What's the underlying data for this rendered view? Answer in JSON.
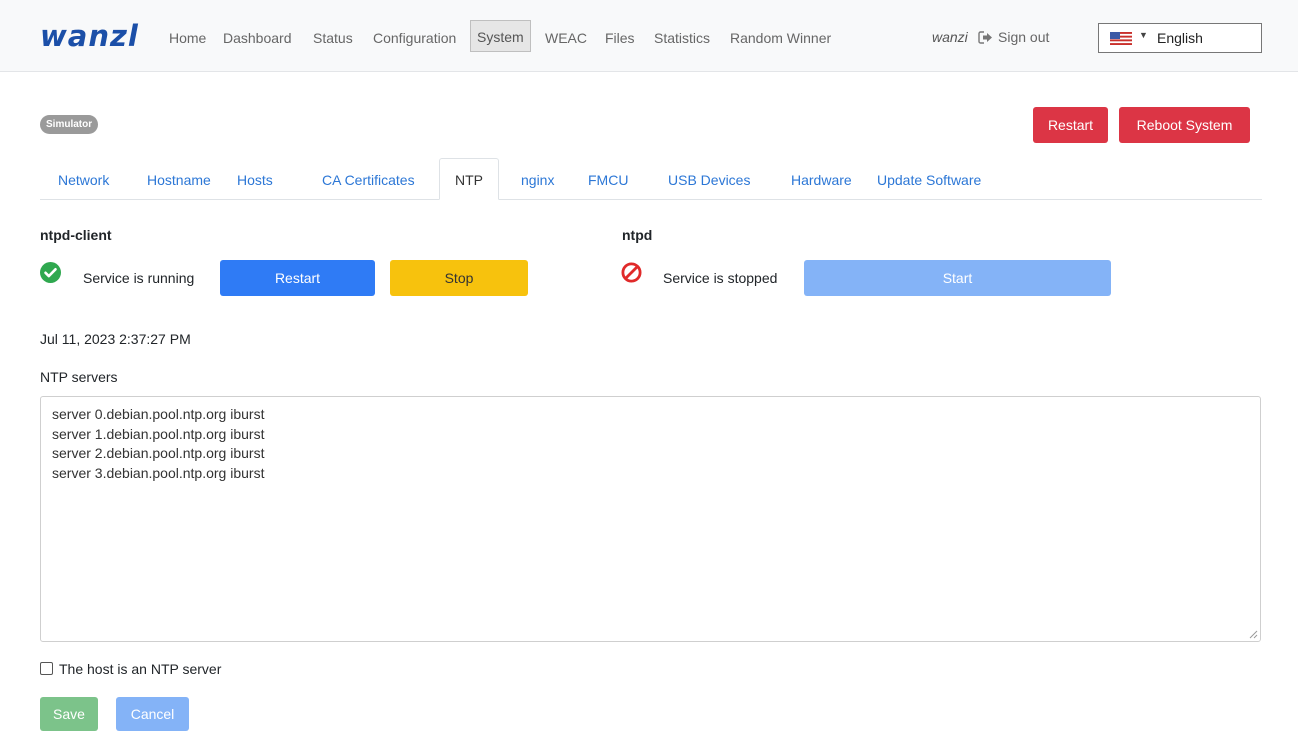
{
  "brand": {
    "logo_text": "wanzl",
    "color": "#1b4fa8"
  },
  "nav": {
    "items": [
      "Home",
      "Dashboard",
      "Status",
      "Configuration",
      "System",
      "WEAC",
      "Files",
      "Statistics",
      "Random Winner"
    ],
    "active": "System"
  },
  "user": {
    "name": "wanzi",
    "signout_label": "Sign out",
    "signout_icon": "sign-out-icon"
  },
  "language": {
    "selected": "English",
    "flag": "us-flag-icon"
  },
  "badge": {
    "label": "Simulator"
  },
  "top_actions": {
    "restart_label": "Restart",
    "reboot_label": "Reboot System"
  },
  "tabs": {
    "items": [
      "Network",
      "Hostname",
      "Hosts",
      "CA Certificates",
      "NTP",
      "nginx",
      "FMCU",
      "USB Devices",
      "Hardware",
      "Update Software"
    ],
    "active": "NTP"
  },
  "services": {
    "client": {
      "name": "ntpd-client",
      "status": "Service is running",
      "status_icon": "check-circle-icon",
      "restart_label": "Restart",
      "stop_label": "Stop"
    },
    "ntpd": {
      "name": "ntpd",
      "status": "Service is stopped",
      "status_icon": "ban-icon",
      "start_label": "Start"
    }
  },
  "timestamp": "Jul 11, 2023 2:37:27 PM",
  "ntp_servers": {
    "label": "NTP servers",
    "lines": [
      "server 0.debian.pool.ntp.org iburst",
      "server 1.debian.pool.ntp.org iburst",
      "server 2.debian.pool.ntp.org iburst",
      "server 3.debian.pool.ntp.org iburst"
    ]
  },
  "ntp_server_checkbox": {
    "label": "The host is an NTP server",
    "checked": false
  },
  "form_actions": {
    "save_label": "Save",
    "cancel_label": "Cancel"
  },
  "colors": {
    "danger": "#dc3545",
    "primary": "#2f7bf5",
    "warning": "#f7c20d",
    "success_icon": "#2fa84f",
    "stopped_icon": "#e02a2a",
    "link": "#2c77d6"
  }
}
